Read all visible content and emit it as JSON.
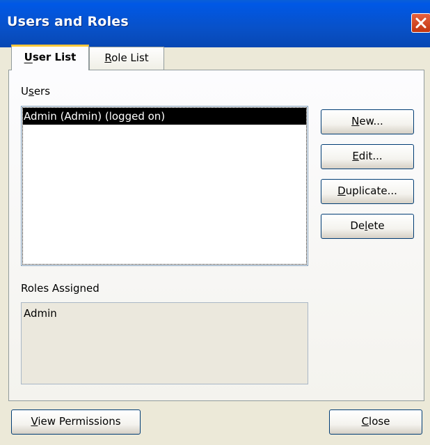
{
  "window": {
    "title": "Users and Roles"
  },
  "tabs": [
    {
      "label": "User List",
      "accel": "U",
      "rest": "ser List",
      "selected": true
    },
    {
      "label": "Role List",
      "accel": "R",
      "rest": "ole List",
      "selected": false
    }
  ],
  "users": {
    "label_pre": "U",
    "label_accel": "s",
    "label_post": "ers",
    "label": "Users",
    "items": [
      "Admin (Admin) (logged on)"
    ],
    "selected_index": 0
  },
  "buttons": {
    "new": {
      "label": "New...",
      "pre": "",
      "accel": "N",
      "post": "ew..."
    },
    "edit": {
      "label": "Edit...",
      "pre": "",
      "accel": "E",
      "post": "dit..."
    },
    "duplicate": {
      "label": "Duplicate...",
      "pre": "",
      "accel": "D",
      "post": "uplicate..."
    },
    "delete": {
      "label": "Delete",
      "pre": "De",
      "accel": "l",
      "post": "ete"
    },
    "view_permissions": {
      "label": "View Permissions",
      "pre": "",
      "accel": "V",
      "post": "iew Permissions"
    },
    "close": {
      "label": "Close",
      "pre": "",
      "accel": "C",
      "post": "lose"
    }
  },
  "roles_assigned": {
    "label": "Roles Assigned",
    "items": [
      "Admin"
    ]
  },
  "colors": {
    "titlebar": "#0851c8",
    "selection_bg": "#000000",
    "dialog_bg": "#ece9d8",
    "tab_highlight": "#ffc83c",
    "close_button": "#c2350f"
  },
  "icons": {
    "close": "close-icon"
  }
}
